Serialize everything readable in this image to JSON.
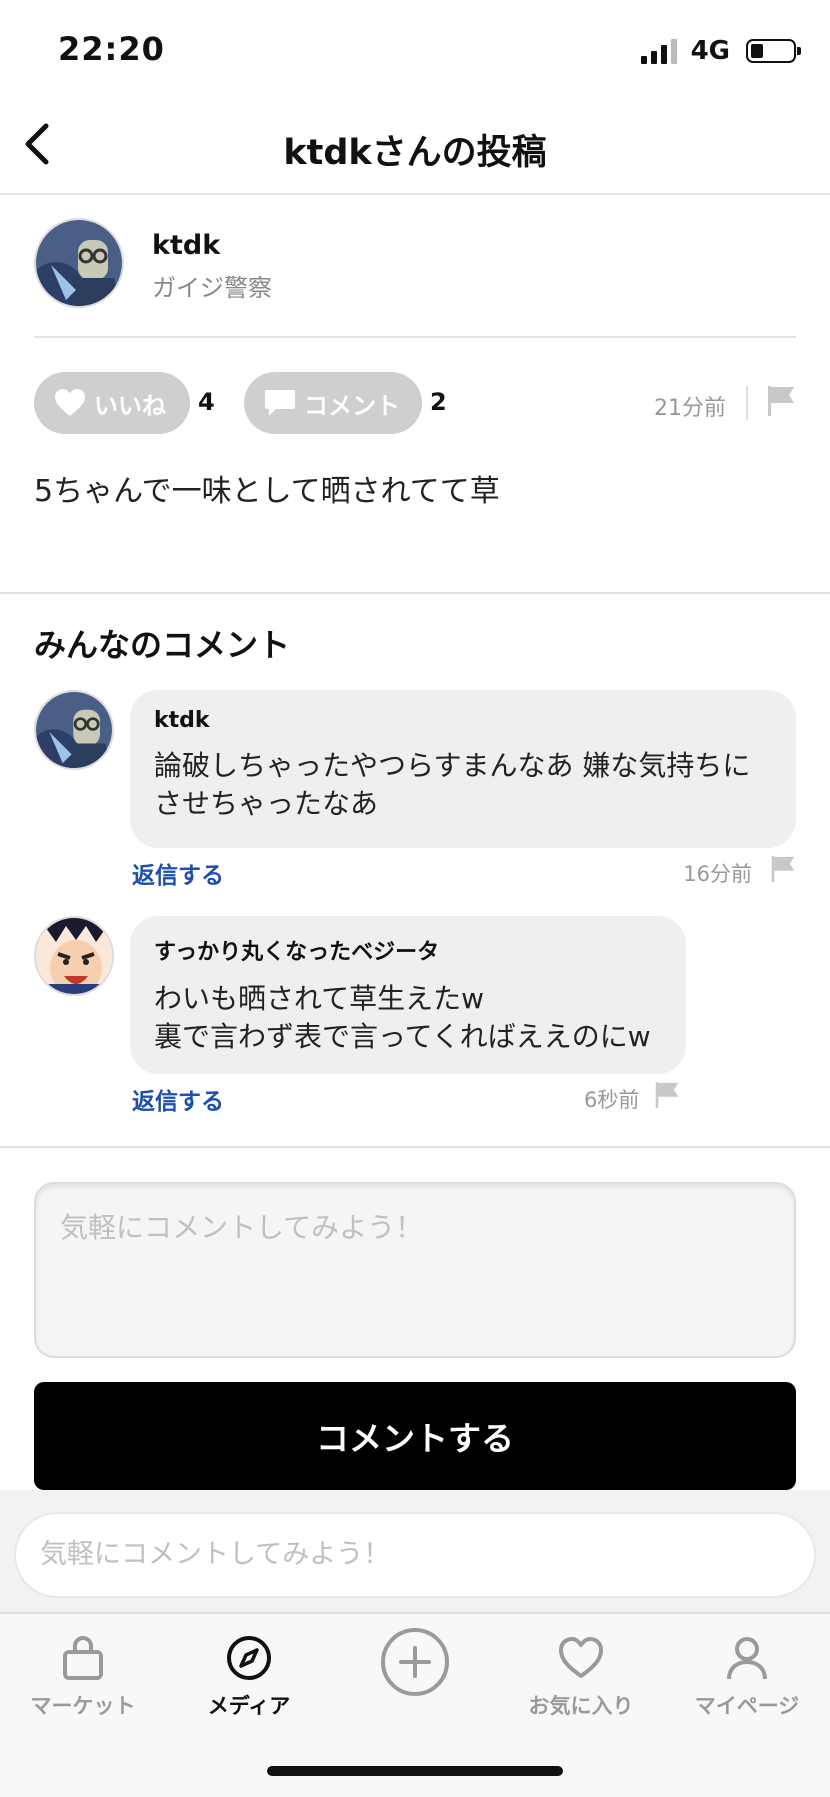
{
  "status_bar": {
    "time": "22:20",
    "network": "4G"
  },
  "header": {
    "title": "ktdkさんの投稿"
  },
  "post": {
    "author_name": "ktdk",
    "author_subtitle": "ガイジ警察",
    "like_label": "いいね",
    "like_count": "4",
    "comment_label": "コメント",
    "comment_count": "2",
    "time": "21分前",
    "body": "5ちゃんで一味として晒されてて草"
  },
  "comments_section": {
    "title": "みんなのコメント",
    "items": [
      {
        "author": "ktdk",
        "lines": [
          "論破しちゃったやつらすまんなあ 嫌な気持ちに",
          "させちゃったなあ"
        ],
        "reply_label": "返信する",
        "time": "16分前"
      },
      {
        "author": "すっかり丸くなったベジータ",
        "lines": [
          "わいも晒されて草生えたw",
          "裏で言わず表で言ってくればええのにw"
        ],
        "reply_label": "返信する",
        "time": "6秒前"
      }
    ]
  },
  "compose": {
    "placeholder": "気軽にコメントしてみよう！",
    "submit_label": "コメントする"
  },
  "bottom_input": {
    "placeholder": "気軽にコメントしてみよう！"
  },
  "tab_bar": {
    "items": [
      {
        "label": "マーケット",
        "icon": "bag-icon",
        "active": false
      },
      {
        "label": "メディア",
        "icon": "compass-icon",
        "active": true
      },
      {
        "label": "",
        "icon": "plus-circle-icon",
        "active": false
      },
      {
        "label": "お気に入り",
        "icon": "heart-icon",
        "active": false
      },
      {
        "label": "マイページ",
        "icon": "person-icon",
        "active": false
      }
    ]
  },
  "colors": {
    "accent_link": "#1e4fb0",
    "pill_gray": "#cfcfcf",
    "submit_black": "#000000"
  }
}
